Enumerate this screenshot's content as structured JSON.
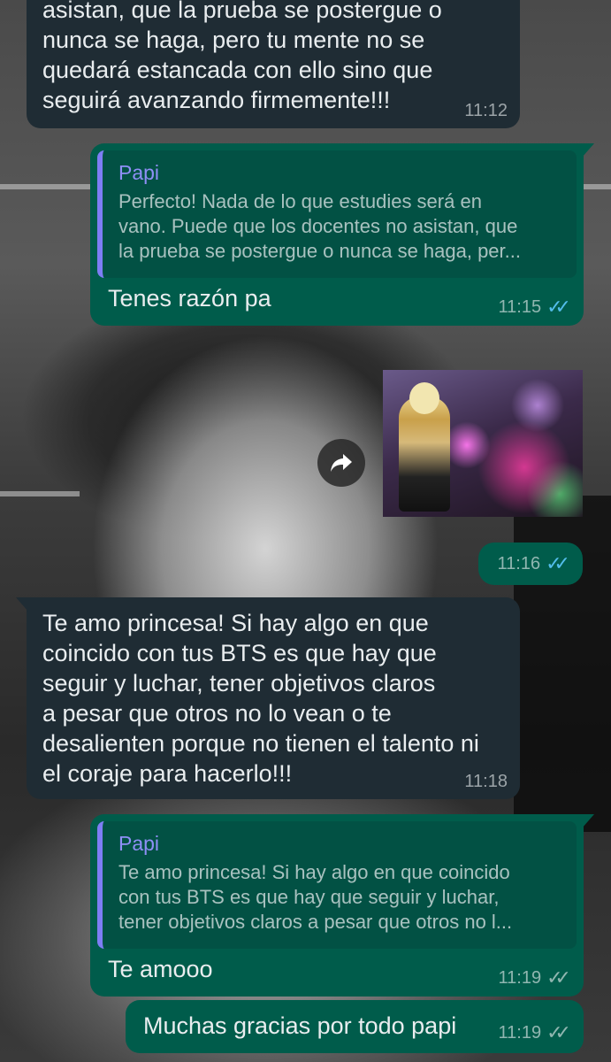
{
  "messages": [
    {
      "lines": [
        "asistan, que la prueba se postergue o",
        "nunca se haga, pero tu mente no se",
        "quedará estancada con ello sino que",
        "seguirá avanzando firmemente!!!"
      ],
      "time": "11:12"
    },
    {
      "quote_author": "Papi",
      "quote_lines": [
        "Perfecto! Nada de lo que estudies será en",
        "vano. Puede que los docentes no asistan, que",
        "la prueba se postergue o nunca se haga, per..."
      ],
      "text": "Tenes razón pa",
      "time": "11:15",
      "ticks": "✓✓"
    },
    {
      "media": "gif-thumbnail",
      "time": "11:16",
      "ticks": "✓✓"
    },
    {
      "lines": [
        "Te amo princesa! Si hay algo en que",
        "coincido con tus BTS es que hay que",
        "seguir y luchar, tener objetivos claros",
        "a pesar que otros no lo vean o te",
        "desalienten porque no tienen el talento ni",
        "el coraje para hacerlo!!!"
      ],
      "time": "11:18"
    },
    {
      "quote_author": "Papi",
      "quote_lines": [
        "Te amo princesa! Si hay algo en que coincido",
        "con tus BTS es que hay que seguir y luchar,",
        "tener objetivos claros a pesar que otros no l..."
      ],
      "text": "Te amooo",
      "time": "11:19",
      "ticks": "✓✓"
    },
    {
      "text": "Muchas gracias por todo papi",
      "time": "11:19",
      "ticks": "✓✓"
    }
  ],
  "icons": {
    "forward": "forward-arrow-icon",
    "read_receipt": "double-check-icon"
  },
  "colors": {
    "incoming_bubble": "#1f2c34",
    "outgoing_bubble": "#005c4b",
    "quote_bar": "#7e7ef5",
    "read_ticks": "#53bdeb",
    "sent_ticks": "#aeb5b8"
  }
}
